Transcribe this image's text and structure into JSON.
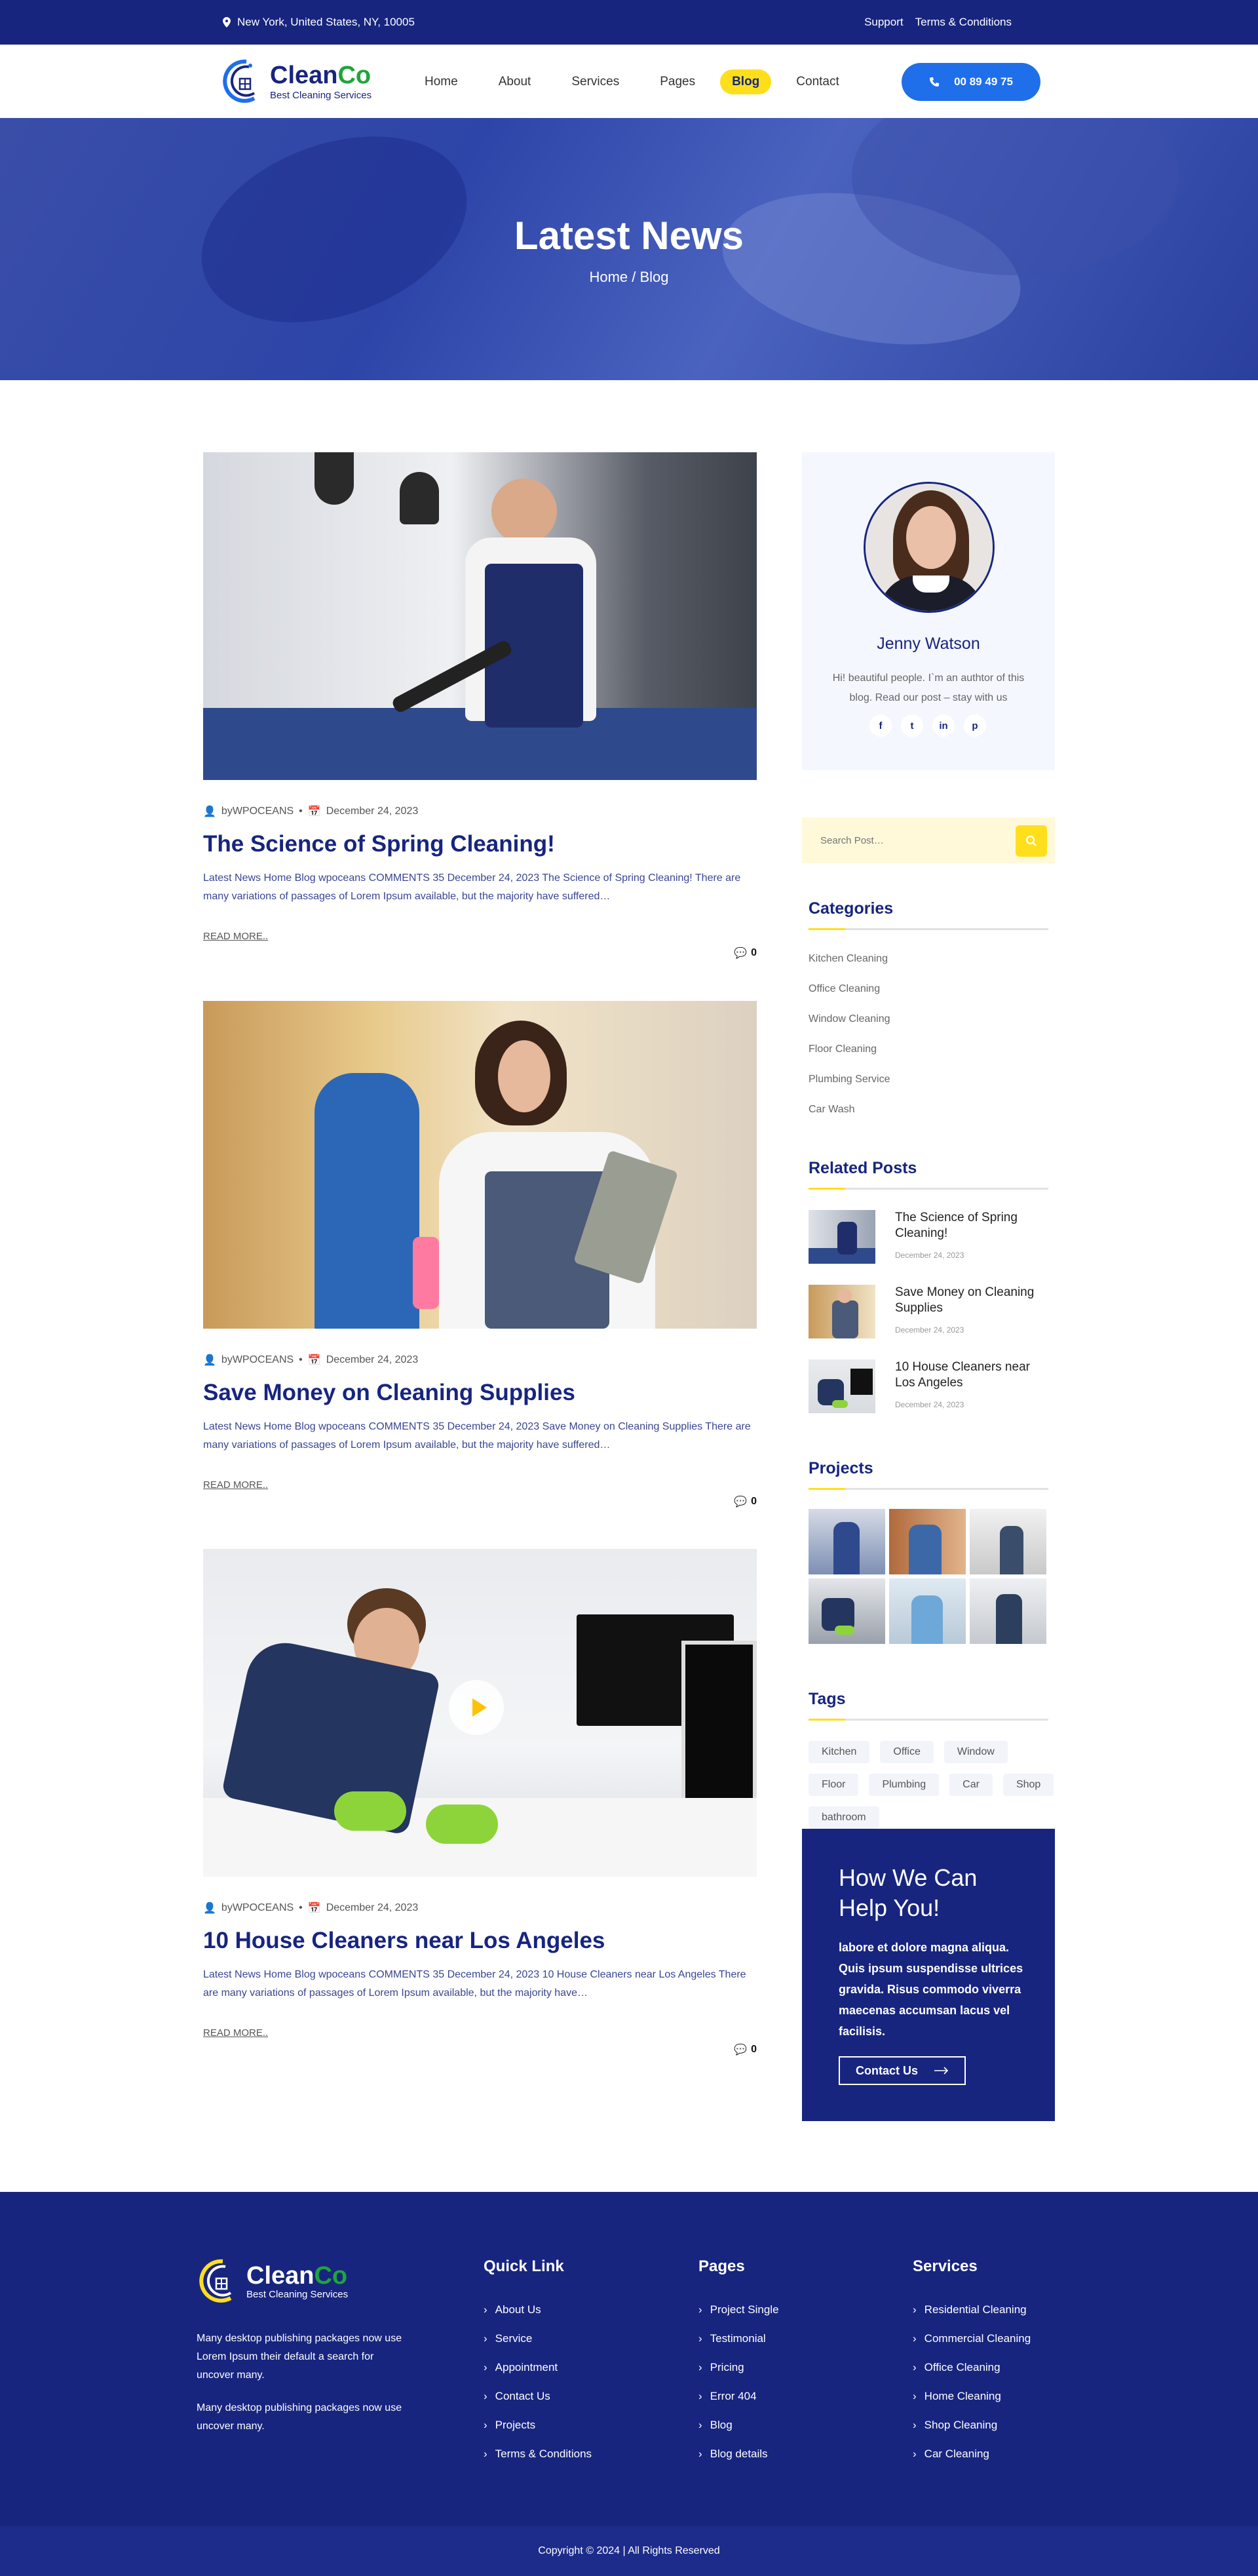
{
  "topbar": {
    "location": "New York, United States, NY, 10005",
    "support": "Support",
    "terms": "Terms & Conditions"
  },
  "header": {
    "brand_main": "Clean",
    "brand_accent": "Co",
    "tagline": "Best Cleaning Services",
    "nav": [
      {
        "label": "Home",
        "active": false
      },
      {
        "label": "About",
        "active": false
      },
      {
        "label": "Services",
        "active": false
      },
      {
        "label": "Pages",
        "active": false
      },
      {
        "label": "Blog",
        "active": true
      },
      {
        "label": "Contact",
        "active": false
      }
    ],
    "phone": "00 89 49 75"
  },
  "hero": {
    "title": "Latest News",
    "breadcrumb_home": "Home",
    "breadcrumb_sep": " / ",
    "breadcrumb_current": "Blog"
  },
  "posts": [
    {
      "author": "byWPOCEANS",
      "date": "December 24, 2023",
      "title": "The Science of Spring Cleaning!",
      "excerpt": "Latest News Home Blog wpoceans COMMENTS 35 December 24, 2023 The Science of Spring Cleaning! There are many variations of passages of Lorem Ipsum available, but the majority have suffered…",
      "read_more": "READ MORE..",
      "comments": "0"
    },
    {
      "author": "byWPOCEANS",
      "date": "December 24, 2023",
      "title": "Save Money on Cleaning Supplies",
      "excerpt": "Latest News Home Blog wpoceans COMMENTS 35 December 24, 2023 Save Money on Cleaning Supplies There are many variations of passages of Lorem Ipsum available, but the majority have suffered…",
      "read_more": "READ MORE..",
      "comments": "0"
    },
    {
      "author": "byWPOCEANS",
      "date": "December 24, 2023",
      "title": "10 House Cleaners near Los Angeles",
      "excerpt": "Latest News Home Blog wpoceans COMMENTS 35 December 24, 2023 10 House Cleaners near Los Angeles There are many variations of passages of Lorem Ipsum available, but the majority have…",
      "read_more": "READ MORE..",
      "comments": "0"
    }
  ],
  "sidebar": {
    "profile": {
      "name": "Jenny Watson",
      "bio": "Hi! beautiful people. I`m an authtor of this blog. Read our post – stay with us",
      "socials": [
        "f",
        "t",
        "in",
        "p"
      ]
    },
    "search": {
      "placeholder": "Search Post…"
    },
    "categories": {
      "title": "Categories",
      "items": [
        "Kitchen Cleaning",
        "Office Cleaning",
        "Window Cleaning",
        "Floor Cleaning",
        "Plumbing Service",
        "Car Wash"
      ]
    },
    "related": {
      "title": "Related Posts",
      "items": [
        {
          "title": "The Science of Spring Cleaning!",
          "date": "December 24, 2023"
        },
        {
          "title": "Save Money on Cleaning Supplies",
          "date": "December 24, 2023"
        },
        {
          "title": "10 House Cleaners near Los Angeles",
          "date": "December 24, 2023"
        }
      ]
    },
    "projects": {
      "title": "Projects"
    },
    "tags": {
      "title": "Tags",
      "items": [
        "Kitchen",
        "Office",
        "Window",
        "Floor",
        "Plumbing",
        "Car",
        "Shop",
        "bathroom"
      ]
    },
    "cta": {
      "title": "How We Can Help You!",
      "text": "labore et dolore magna aliqua. Quis ipsum suspendisse ultrices gravida. Risus commodo viverra maecenas accumsan lacus vel facilisis.",
      "button": "Contact Us"
    }
  },
  "footer": {
    "brand_main": "Clean",
    "brand_accent": "Co",
    "tagline": "Best Cleaning Services",
    "about_1": "Many desktop publishing packages now use Lorem Ipsum their default a search for uncover many.",
    "about_2": "Many desktop publishing packages now use uncover many.",
    "quick": {
      "title": "Quick Link",
      "items": [
        "About Us",
        "Service",
        "Appointment",
        "Contact Us",
        "Projects",
        "Terms & Conditions"
      ]
    },
    "pages": {
      "title": "Pages",
      "items": [
        "Project Single",
        "Testimonial",
        "Pricing",
        "Error 404",
        "Blog",
        "Blog details"
      ]
    },
    "services": {
      "title": "Services",
      "items": [
        "Residential Cleaning",
        "Commercial Cleaning",
        "Office Cleaning",
        "Home Cleaning",
        "Shop Cleaning",
        "Car Cleaning"
      ]
    },
    "copyright": "Copyright © 2024 | All Rights Reserved"
  },
  "colors": {
    "primary": "#17257f",
    "accent": "#ffdf1c",
    "brand_green": "#1ea53a",
    "phone_btn": "#1f6feb"
  }
}
